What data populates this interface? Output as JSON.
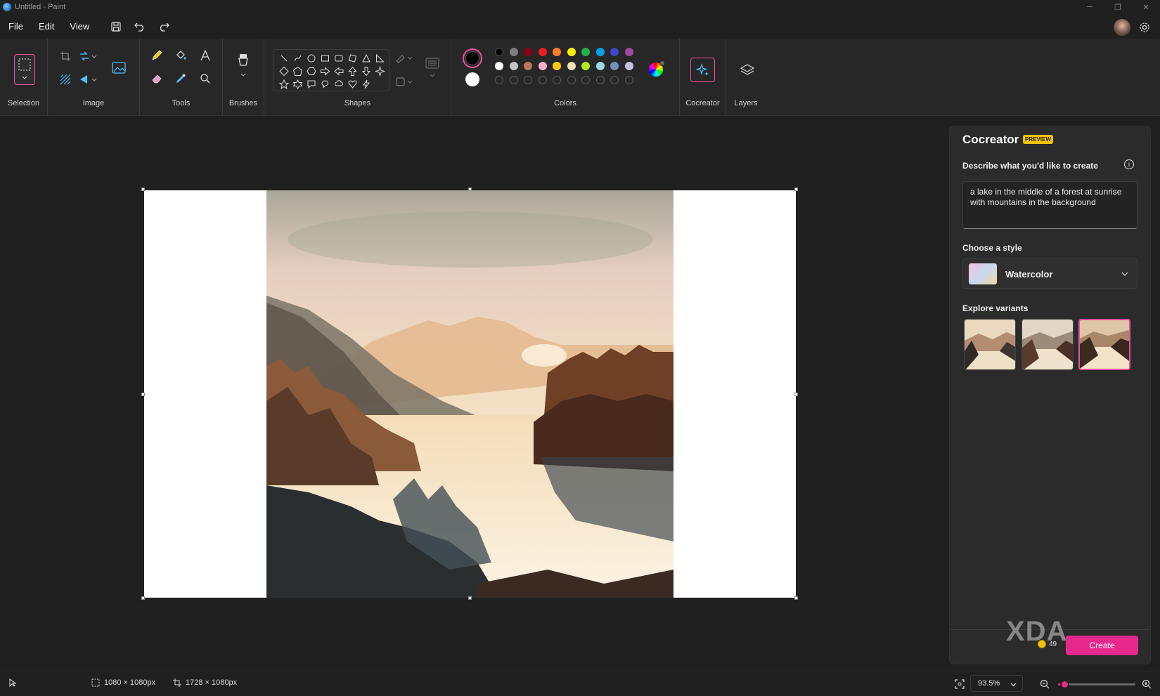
{
  "window": {
    "title": "Untitled - Paint"
  },
  "menu": {
    "file": "File",
    "edit": "Edit",
    "view": "View"
  },
  "ribbon": {
    "selection": "Selection",
    "image": "Image",
    "tools": "Tools",
    "brushes": "Brushes",
    "shapes": "Shapes",
    "colors": "Colors",
    "cocreator": "Cocreator",
    "layers": "Layers",
    "palette_row1": [
      "#000000",
      "#7f7f7f",
      "#880015",
      "#ed1c24",
      "#ff7f27",
      "#fff200",
      "#22b14c",
      "#00a2e8",
      "#3f48cc",
      "#a349a4"
    ],
    "palette_row2": [
      "#ffffff",
      "#c3c3c3",
      "#b97a57",
      "#ffaec9",
      "#ffc90e",
      "#efe4b0",
      "#b5e61d",
      "#99d9ea",
      "#7092be",
      "#c8bfe7"
    ],
    "primary_color": "#000000",
    "secondary_color": "#ffffff"
  },
  "cocreator": {
    "title": "Cocreator",
    "badge": "PREVIEW",
    "describe_label": "Describe what you'd like to create",
    "prompt": "a lake in the middle of a forest at sunrise with mountains in the background",
    "style_label": "Choose a style",
    "style_value": "Watercolor",
    "variants_label": "Explore variants",
    "selected_variant": 3,
    "credits": "49",
    "create_label": "Create",
    "watermark": "XDA"
  },
  "status": {
    "selection_size": "1080 × 1080px",
    "canvas_size": "1728 × 1080px",
    "zoom": "93.5%",
    "zoom_level": 0.08
  }
}
